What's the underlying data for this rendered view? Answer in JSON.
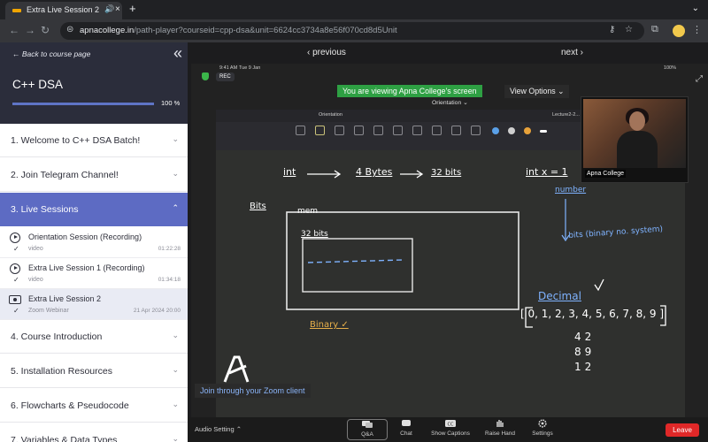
{
  "browser": {
    "tab_title": "Extra Live Session 2",
    "tab_audio_icon": "speaker-icon",
    "tab_close": "×",
    "new_tab": "+",
    "url_host": "apnacollege.in",
    "url_path": "/path-player?courseid=cpp-dsa&unit=6624cc3734a8e56f070cd8d5Unit"
  },
  "sidebar": {
    "back_link": "← Back to course page",
    "collapse_icon": "«",
    "course_title": "C++ DSA",
    "progress_text": "100 %",
    "progress": 1.0,
    "accent_color": "#5d6bc3",
    "sections": [
      {
        "label": "1. Welcome to C++ DSA Batch!",
        "chevron": "⌄"
      },
      {
        "label": "2. Join Telegram Channel!",
        "chevron": "⌄"
      },
      {
        "label": "3. Live Sessions",
        "chevron": "⌃"
      },
      {
        "label": "4. Course Introduction",
        "chevron": "⌄"
      },
      {
        "label": "5. Installation Resources",
        "chevron": "⌄"
      },
      {
        "label": "6. Flowcharts & Pseudocode",
        "chevron": "⌄"
      },
      {
        "label": "7. Variables & Data Types",
        "chevron": "⌄"
      }
    ],
    "lessons": [
      {
        "title": "Orientation Session (Recording)",
        "sub": "video",
        "time": "01:22:28",
        "check": "✓"
      },
      {
        "title": "Extra Live Session 1 (Recording)",
        "sub": "video",
        "time": "01:34:18",
        "check": "✓"
      },
      {
        "title": "Extra Live Session 2",
        "sub": "Zoom Webinar",
        "time": "21 Apr 2024 20:00",
        "check": "✓"
      }
    ]
  },
  "player": {
    "prev": "‹ previous",
    "next": "next ›",
    "banner": "You are viewing Apna College's screen",
    "view_options": "View Options ⌄",
    "rec": "REC",
    "doc_title": "Orientation ⌄",
    "status_time": "9:41 AM",
    "status_date": "Tue 9 Jan",
    "status_batt": "100%",
    "app_tab_left": "Orientation",
    "app_tab_right": "Lecture2-2...",
    "video_name": "Apna College",
    "join_banner": "Join through your Zoom client",
    "audio_setting": "Audio Setting ⌃",
    "controls": [
      {
        "label": "Q&A"
      },
      {
        "label": "Chat"
      },
      {
        "label": "Show Captions"
      },
      {
        "label": "Raise Hand"
      },
      {
        "label": "Settings"
      }
    ],
    "leave": "Leave"
  },
  "board": {
    "int": "int",
    "bytes": "4 Bytes",
    "bits32": "32 bits",
    "intx": "int x = 1",
    "number": "number",
    "bits": "Bits",
    "mem": "mem",
    "bits32b": "32 bits",
    "binary": "Binary ✓",
    "bits_binary": "bits (binary no. system)",
    "decimal": "Decimal",
    "digits": "[ 0, 1, 2, 3, 4, 5, 6, 7, 8, 9 ]",
    "n42": "42",
    "n89": "89",
    "n12": "12"
  }
}
